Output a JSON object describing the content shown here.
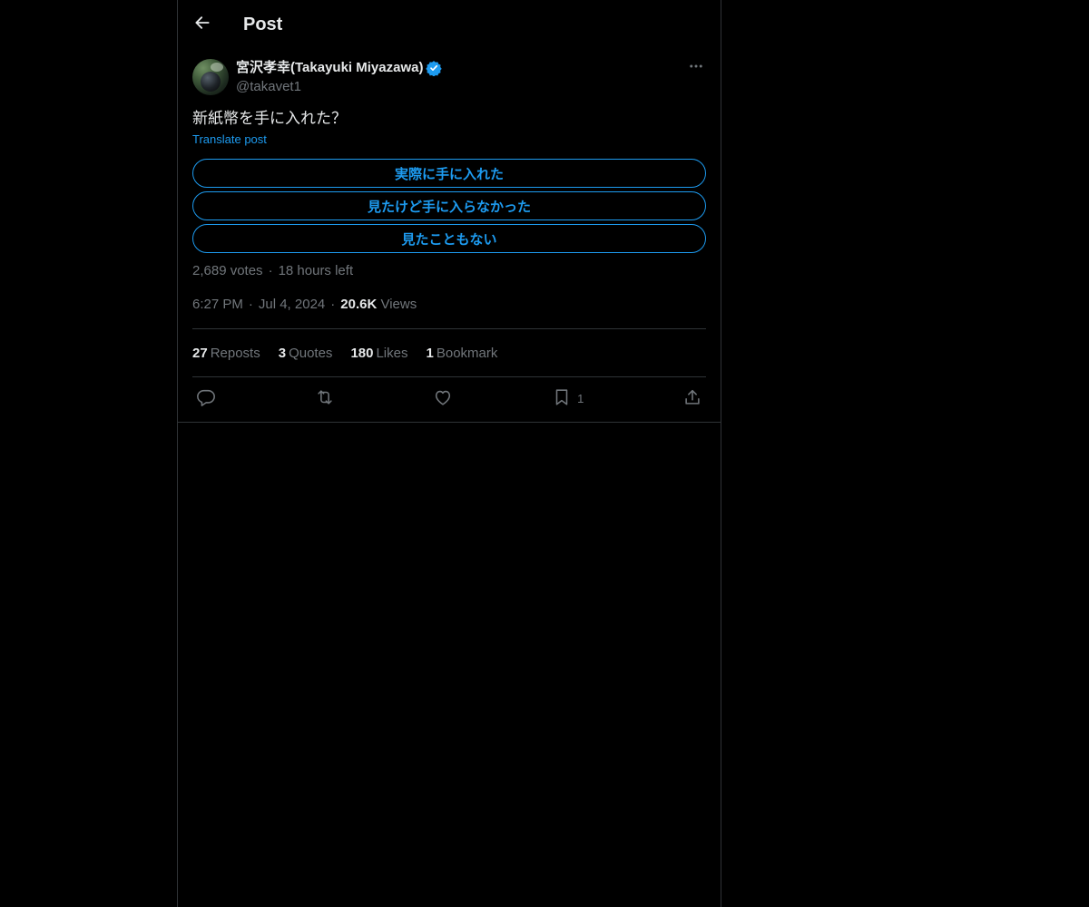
{
  "header": {
    "title": "Post"
  },
  "post": {
    "author": {
      "display_name": "宮沢孝幸(Takayuki Miyazawa)",
      "handle": "@takavet1",
      "verified": true
    },
    "text": "新紙幣を手に入れた？",
    "translate_label": "Translate post",
    "poll": {
      "options": [
        "実際に手に入れた",
        "見たけど手に入らなかった",
        "見たこともない"
      ],
      "votes": "2,689 votes",
      "time_left": "18 hours left"
    },
    "time": "6:27 PM",
    "date": "Jul 4, 2024",
    "views_count": "20.6K",
    "views_label": "Views",
    "stats": {
      "reposts_count": "27",
      "reposts_label": "Reposts",
      "quotes_count": "3",
      "quotes_label": "Quotes",
      "likes_count": "180",
      "likes_label": "Likes",
      "bookmarks_count": "1",
      "bookmarks_label": "Bookmark"
    },
    "actions": {
      "bookmark_count": "1"
    }
  },
  "colors": {
    "background": "#000000",
    "accent": "#1d9bf0",
    "text_primary": "#e7e9ea",
    "text_secondary": "#71767b",
    "border": "#2f3336"
  },
  "icons": [
    "back-arrow-icon",
    "verified-badge-icon",
    "more-icon",
    "reply-icon",
    "repost-icon",
    "like-icon",
    "bookmark-icon",
    "share-icon"
  ]
}
